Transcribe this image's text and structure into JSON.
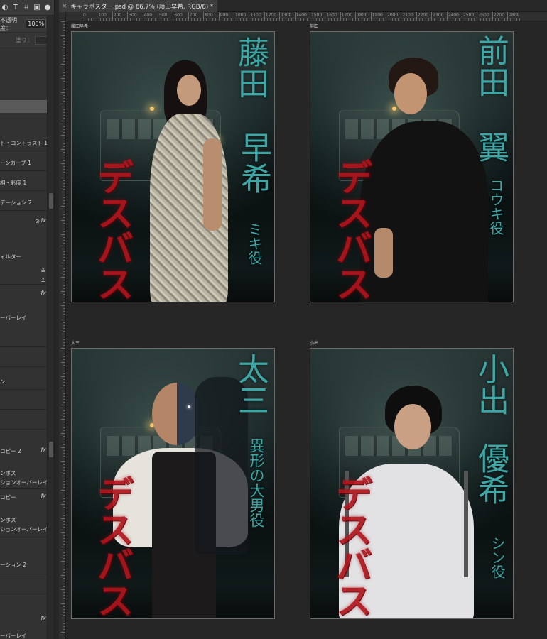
{
  "document": {
    "tab_title": "キャラポスター.psd @ 66.7% (藤田早希, RGB/8) *"
  },
  "layers_panel": {
    "opacity_label": "不透明度：",
    "opacity_value": "100%",
    "fill_label": "塗り：",
    "layers": [
      "ト・コントラスト 1",
      "ーンカーブ 1",
      "相・彩度 1",
      "デーション 2",
      "ィルター",
      "ーバーレイ",
      "ン",
      "コピー 2",
      "ンボス",
      "ションオーバーレイ",
      "コピー",
      "ンボス",
      "ションオーバーレイ",
      "ーション 2",
      "ーバーレイ"
    ]
  },
  "ruler": {
    "h_labels": [
      "0",
      "100",
      "200",
      "300",
      "400",
      "500",
      "600",
      "700",
      "800",
      "900",
      "1000",
      "1100",
      "1200",
      "1300",
      "1400",
      "1500",
      "1600",
      "1700",
      "1800",
      "1900",
      "2000",
      "2100",
      "2200",
      "2300",
      "2400",
      "2500",
      "2600",
      "2700",
      "2800"
    ]
  },
  "artboards": [
    {
      "label": "藤田早希",
      "name": "藤田 早希",
      "name_line1": "藤田",
      "name_line2": "早希",
      "role": "ミキ役",
      "title": "デスバス"
    },
    {
      "label": "前田",
      "name_line1": "前田",
      "name_line2": "翼",
      "role": "コウキ役",
      "title": "デスバス"
    },
    {
      "label": "太三",
      "name_line1": "太三",
      "role": "異形の大男役",
      "title": "デスバス"
    },
    {
      "label": "小出",
      "name_line1": "小出",
      "name_line2": "優希",
      "role": "シン役",
      "title": "デスバス"
    }
  ],
  "colors": {
    "name_teal": "#3fa6a6",
    "title_red": "#b0141c",
    "panel_bg": "#323232",
    "canvas_bg": "#262626"
  }
}
